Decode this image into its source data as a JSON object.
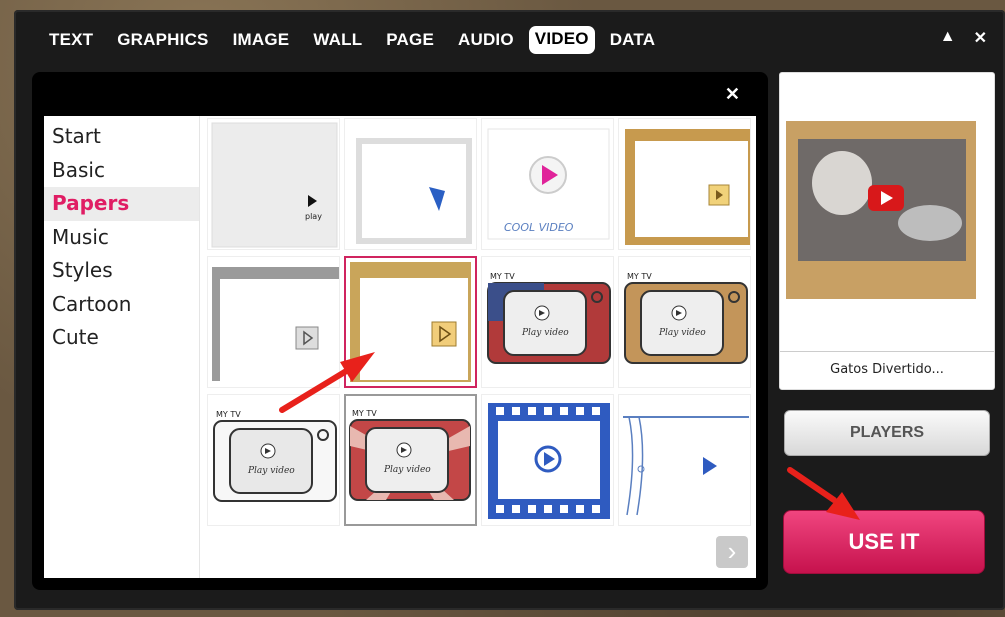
{
  "tabs": [
    {
      "label": "TEXT"
    },
    {
      "label": "GRAPHICS"
    },
    {
      "label": "IMAGE"
    },
    {
      "label": "WALL"
    },
    {
      "label": "PAGE"
    },
    {
      "label": "AUDIO"
    },
    {
      "label": "VIDEO",
      "active": true
    },
    {
      "label": "DATA"
    }
  ],
  "window_controls": {
    "collapse": "▲",
    "close": "✕"
  },
  "panel": {
    "close": "✕"
  },
  "categories": [
    {
      "label": "Start"
    },
    {
      "label": "Basic"
    },
    {
      "label": "Papers",
      "active": true
    },
    {
      "label": "Music"
    },
    {
      "label": "Styles"
    },
    {
      "label": "Cartoon"
    },
    {
      "label": "Cute"
    }
  ],
  "tiles": {
    "t1_text": "play",
    "t3_text": "COOL VIDEO",
    "tv_label": "Play video",
    "tv_header": "MY TV"
  },
  "next_button": "›",
  "preview": {
    "caption": "Gatos Divertido..."
  },
  "players_button": "PLAYERS",
  "use_button": "USE IT",
  "colors": {
    "accent": "#e01d64",
    "use_button": "#d81a57",
    "arrow": "#e8211b"
  }
}
